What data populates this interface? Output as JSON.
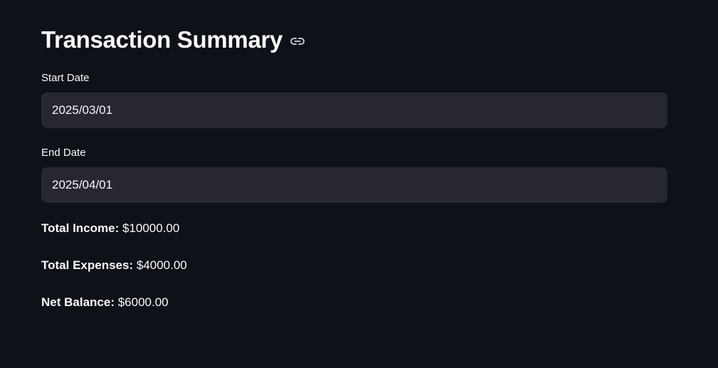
{
  "header": {
    "title": "Transaction Summary",
    "link_icon": "link-icon"
  },
  "form": {
    "start_date": {
      "label": "Start Date",
      "value": "2025/03/01"
    },
    "end_date": {
      "label": "End Date",
      "value": "2025/04/01"
    }
  },
  "summary": {
    "income_label": "Total Income:",
    "income_value": " $10000.00",
    "expenses_label": "Total Expenses:",
    "expenses_value": " $4000.00",
    "balance_label": "Net Balance:",
    "balance_value": " $6000.00"
  },
  "colors": {
    "background": "#0e1117",
    "input_background": "#262730",
    "text": "#fafafa"
  }
}
